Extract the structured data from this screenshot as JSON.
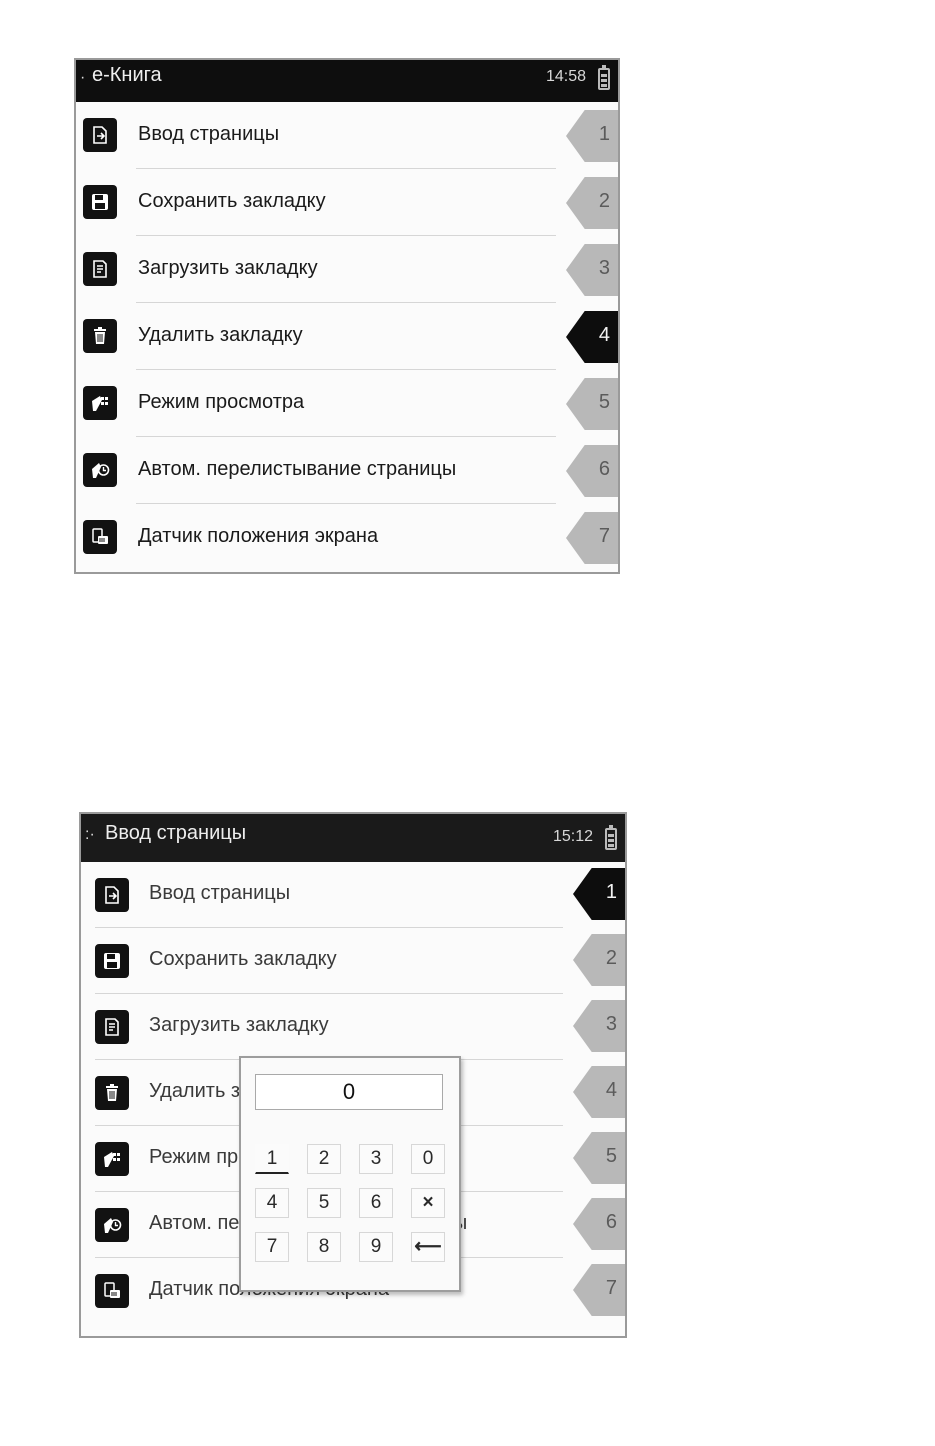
{
  "screen_top": {
    "title": "e-Книга",
    "time": "14:58",
    "items": [
      {
        "label": "Ввод страницы",
        "num": "1"
      },
      {
        "label": "Сохранить закладку",
        "num": "2"
      },
      {
        "label": "Загрузить закладку",
        "num": "3"
      },
      {
        "label": "Удалить закладку",
        "num": "4"
      },
      {
        "label": "Режим просмотра",
        "num": "5"
      },
      {
        "label": "Автом. перелистывание страницы",
        "num": "6"
      },
      {
        "label": "Датчик положения экрана",
        "num": "7"
      }
    ],
    "selected_item": "4"
  },
  "screen_bottom": {
    "title": "Ввод страницы",
    "time": "15:12",
    "items": [
      {
        "label": "Ввод страницы",
        "num": "1"
      },
      {
        "label": "Сохранить закладку",
        "num": "2"
      },
      {
        "label": "Загрузить закладку",
        "num": "3"
      },
      {
        "label": "Удалить закладку",
        "num": "4"
      },
      {
        "label": "Режим просмотра",
        "num": "5"
      },
      {
        "label": "Автом. перелистывание страницы",
        "num": "6"
      },
      {
        "label": "Датчик положения экрана",
        "num": "7"
      }
    ],
    "selected_item": "1",
    "keypad": {
      "display": "0",
      "keys": [
        "1",
        "2",
        "3",
        "0",
        "4",
        "5",
        "6",
        "×",
        "7",
        "8",
        "9",
        "⟵"
      ],
      "focused_key": "1"
    }
  },
  "icons": [
    "page-enter-icon",
    "floppy-disk-icon",
    "load-bookmark-icon",
    "trash-icon",
    "view-mode-icon",
    "auto-flip-icon",
    "orientation-sensor-icon"
  ]
}
